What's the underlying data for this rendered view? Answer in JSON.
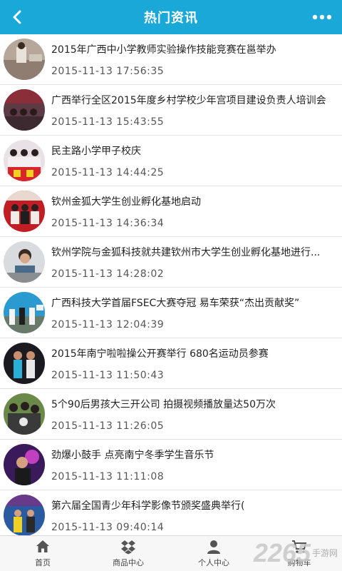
{
  "header": {
    "title": "热门资讯",
    "back_icon": "back-arrow-icon",
    "more_icon": "more-dots-icon",
    "color": "#1aa8d8"
  },
  "news": [
    {
      "title": "2015年广西中小学教师实验操作技能竞赛在邕举办",
      "time": "2015-11-13 17:56:35"
    },
    {
      "title": "广西举行全区2015年度乡村学校少年宫项目建设负责人培训会",
      "time": "2015-11-13 15:43:55"
    },
    {
      "title": "民主路小学甲子校庆",
      "time": "2015-11-13 14:44:25"
    },
    {
      "title": "钦州金狐大学生创业孵化基地启动",
      "time": "2015-11-13 14:36:34"
    },
    {
      "title": "钦州学院与金狐科技就共建钦州市大学生创业孵化基地进行...",
      "time": "2015-11-13 14:28:02"
    },
    {
      "title": "广西科技大学首届FSEC大赛夺冠 易车荣获“杰出贡献奖”",
      "time": "2015-11-13 12:04:39"
    },
    {
      "title": "2015年南宁啦啦操公开赛举行 680名运动员参赛",
      "time": "2015-11-13 11:50:43"
    },
    {
      "title": "5个90后男孩大三开公司 拍摄视频播放量达50万次",
      "time": "2015-11-13 11:26:05"
    },
    {
      "title": "劲爆小鼓手 点亮南宁冬季学生音乐节",
      "time": "2015-11-13 11:11:08"
    },
    {
      "title": "第六届全国青少年科学影像节颁奖盛典举行(",
      "time": "2015-11-13 09:40:14"
    }
  ],
  "tabbar": [
    {
      "label": "首页",
      "icon": "home-icon"
    },
    {
      "label": "商品中心",
      "icon": "dropbox-icon"
    },
    {
      "label": "个人中心",
      "icon": "person-icon"
    },
    {
      "label": "购物车",
      "icon": "cart-icon"
    }
  ],
  "watermark": {
    "number": "2265",
    "text": "手游网"
  }
}
